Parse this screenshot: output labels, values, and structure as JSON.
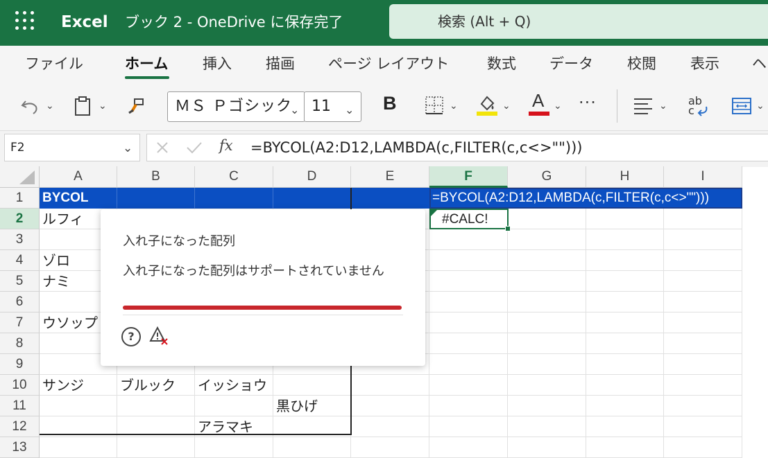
{
  "app": {
    "name": "Excel",
    "doc_title": "ブック 2 - OneDrive に保存完了",
    "search_placeholder": "検索 (Alt + Q)"
  },
  "menu": [
    "ファイル",
    "ホーム",
    "挿入",
    "描画",
    "ページ レイアウト",
    "数式",
    "データ",
    "校閲",
    "表示",
    "ヘ"
  ],
  "toolbar": {
    "font_name": "ＭＳ Ｐゴシック",
    "font_size": "11",
    "bold": "B",
    "font_color_letter": "A",
    "highlight_color": "#f2e40a",
    "font_color": "#d6121c",
    "more": "···"
  },
  "formula_bar": {
    "name_box": "F2",
    "fx": "fx",
    "formula": "=BYCOL(A2:D12,LAMBDA(c,FILTER(c,c<>\"\")))"
  },
  "columns": [
    "A",
    "B",
    "C",
    "D",
    "E",
    "F",
    "G",
    "H",
    "I"
  ],
  "rows": [
    "1",
    "2",
    "3",
    "4",
    "5",
    "6",
    "7",
    "8",
    "9",
    "10",
    "11",
    "12",
    "13"
  ],
  "cells": {
    "A1": "BYCOL",
    "A2": "ルフィ",
    "A4": "ゾロ",
    "A5": "ナミ",
    "A7": "ウソップ",
    "A10": "サンジ",
    "B10": "ブルック",
    "C10": "イッショウ",
    "D11": "黒ひげ",
    "C12": "アラマキ",
    "F1": "=BYCOL(A2:D12,LAMBDA(c,FILTER(c,c<>\"\")))",
    "F2": "#CALC!"
  },
  "error_popup": {
    "title": "入れ子になった配列",
    "message": "入れ子になった配列はサポートされていません"
  },
  "colors": {
    "brand_green": "#1a7343",
    "header_fill": "#0b4fc2",
    "error_red": "#c8262c"
  }
}
